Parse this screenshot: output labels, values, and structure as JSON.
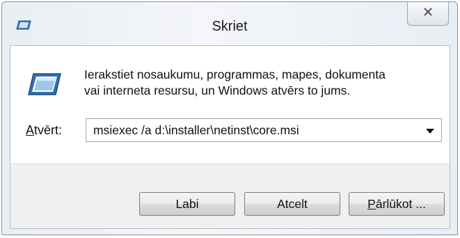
{
  "window": {
    "title": "Skriet",
    "title_icon": "run-icon",
    "close_icon": "close-icon"
  },
  "dialog": {
    "icon": "run-program-icon",
    "description_line1": "Ierakstiet nosaukumu, programmas, mapes, dokumenta",
    "description_line2": "vai interneta resursu, un Windows atvērs to jums.",
    "open_label_accel": "A",
    "open_label_rest": "tvērt:",
    "open_value": "msiexec /a d:\\installer\\netinst\\core.msi",
    "dropdown_icon": "chevron-down-icon"
  },
  "buttons": {
    "ok_label": "Labi",
    "cancel_label": "Atcelt",
    "browse_label_accel": "P",
    "browse_label_rest": "ārlūkot ..."
  },
  "colors": {
    "titlebar_bg": "#e9eef4",
    "content_bg": "#ffffff",
    "footer_bg": "#f0f0f0",
    "icon_blue": "#2f6fb5"
  }
}
